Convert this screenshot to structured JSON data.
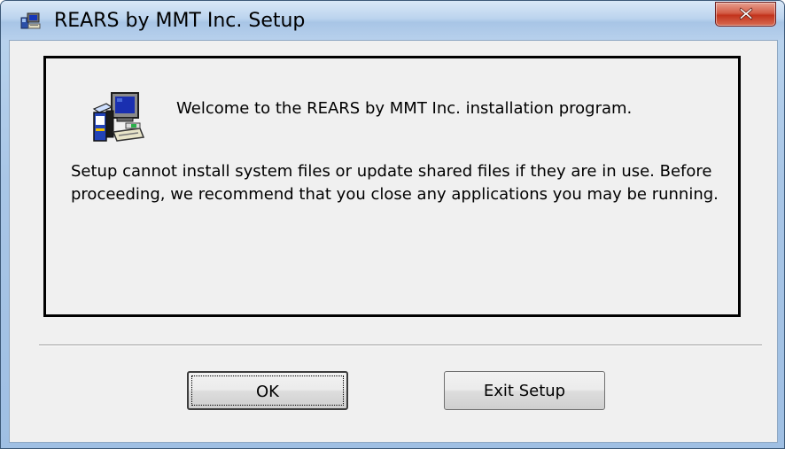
{
  "window": {
    "title": "REARS by MMT Inc. Setup",
    "close_symbol": "X"
  },
  "content": {
    "welcome": "Welcome to the REARS by MMT Inc. installation program.",
    "message": "Setup cannot install system files or update shared files if they are in use. Before proceeding, we recommend that you close any applications you may be running."
  },
  "buttons": {
    "ok_label": "OK",
    "exit_label": "Exit Setup"
  },
  "icons": {
    "title": "setup-computer-icon",
    "main": "setup-computer-icon",
    "close": "close-icon"
  },
  "colors": {
    "title_bar": "#bcd4ee",
    "close_button": "#c2331c",
    "dialog_background": "#f0f0f0",
    "panel_border": "#000000"
  }
}
